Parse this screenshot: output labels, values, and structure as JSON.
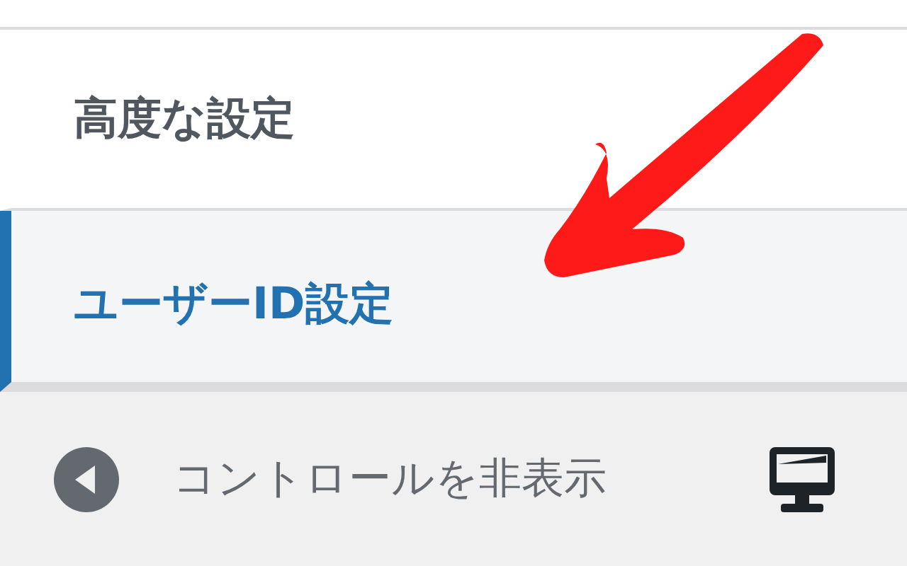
{
  "sections": [
    {
      "label": "高度な設定",
      "selected": false
    },
    {
      "label": "ユーザーID設定",
      "selected": true
    }
  ],
  "footer": {
    "collapse_label": "コントロールを非表示"
  },
  "annotations": [
    {
      "kind": "arrow"
    }
  ]
}
